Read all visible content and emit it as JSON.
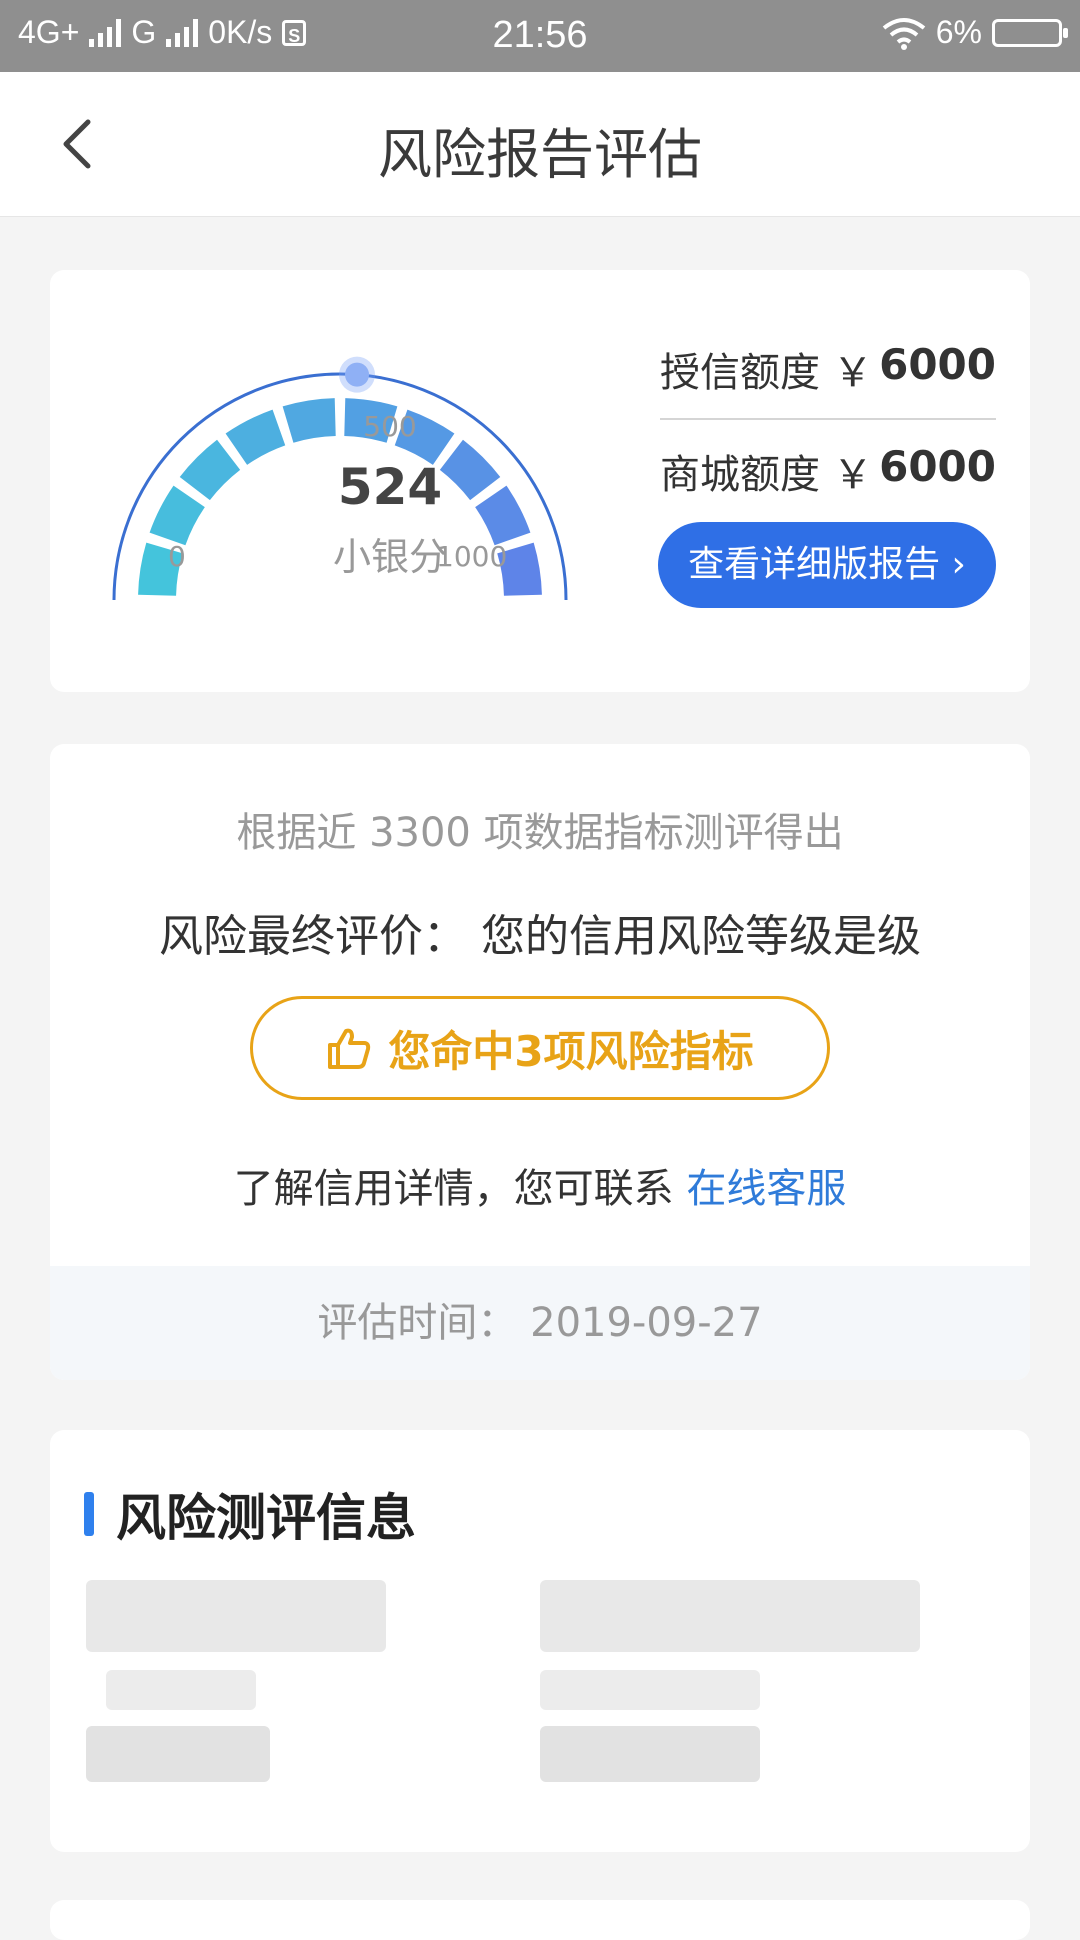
{
  "status_bar": {
    "network_1": "4G+",
    "network_2": "G",
    "speed": "0K/s",
    "sim_icon": "S",
    "time": "21:56",
    "battery": "6%"
  },
  "nav": {
    "title": "风险报告评估"
  },
  "gauge": {
    "score": "524",
    "label": "小银分",
    "tick_min": "0",
    "tick_mid": "500",
    "tick_max": "1000"
  },
  "limits": {
    "credit_label": "授信额度 ￥",
    "credit_value": "6000",
    "mall_label": "商城额度 ￥",
    "mall_value": "6000",
    "report_button": "查看详细版报告 ›"
  },
  "evaluation": {
    "subtitle": "根据近 3300 项数据指标测评得出",
    "final": "风险最终评价：  您的信用风险等级是级",
    "risk_pill": "您命中3项风险指标",
    "contact_prefix": "了解信用详情，您可联系 ",
    "contact_link": "在线客服",
    "time": "评估时间：  2019-09-27"
  },
  "info": {
    "title": "风险测评信息"
  },
  "colors": {
    "accent_blue": "#2f6fe6",
    "pill_orange": "#e8a317",
    "link_blue": "#2f7bd9"
  },
  "icons": {
    "back": "chevron-left-icon",
    "thumbs_up": "thumbs-up-icon",
    "wifi": "wifi-icon",
    "battery": "battery-icon"
  }
}
